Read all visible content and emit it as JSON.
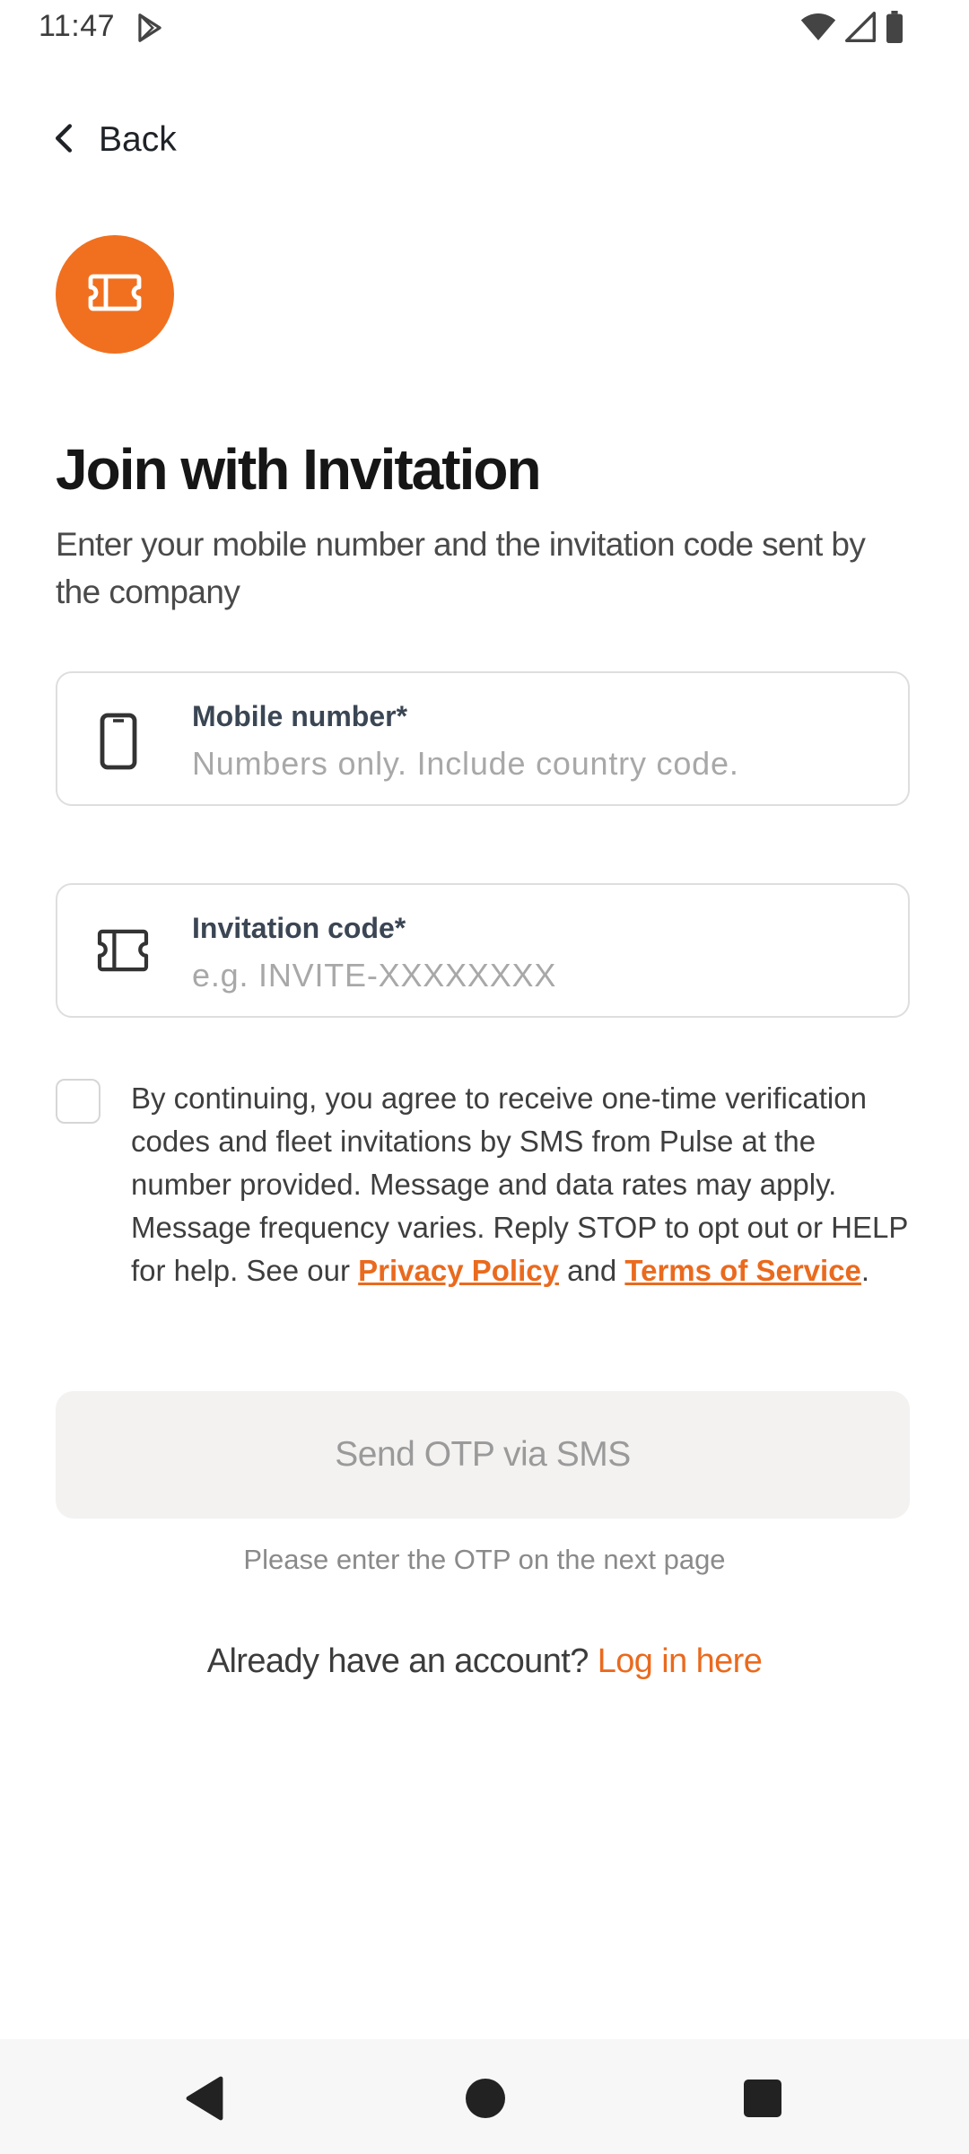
{
  "status_bar": {
    "time": "11:47",
    "icons": [
      "play-store-icon",
      "wifi-icon",
      "cell-signal-icon",
      "battery-icon"
    ]
  },
  "header": {
    "back_label": "Back",
    "back_icon": "chevron-left-icon"
  },
  "brand": {
    "icon": "ticket-icon",
    "accent_color": "#f07020"
  },
  "page": {
    "title": "Join with Invitation",
    "subtitle": "Enter your mobile number and the invitation code sent by the company"
  },
  "fields": {
    "mobile": {
      "icon": "phone-icon",
      "label": "Mobile number*",
      "placeholder": "Numbers only. Include country code.",
      "value": ""
    },
    "invitation": {
      "icon": "ticket-icon",
      "label": "Invitation code*",
      "placeholder": "e.g. INVITE-XXXXXXXX",
      "value": ""
    }
  },
  "consent": {
    "checked": false,
    "text_before": "By continuing, you agree to receive one-time verification codes and fleet invitations by SMS from Pulse at the number provided. Message and data rates may apply. Message frequency varies. Reply STOP to opt out or HELP for help. See our ",
    "privacy_link": "Privacy Policy",
    "text_and": " and ",
    "terms_link": "Terms of Service",
    "text_after": "."
  },
  "actions": {
    "send_otp_label": "Send OTP via SMS",
    "otp_hint": "Please enter the OTP on the next page",
    "login_prompt": "Already have an account? ",
    "login_link": "Log in here"
  },
  "nav_bar": {
    "icons": [
      "nav-back-icon",
      "nav-home-icon",
      "nav-recents-icon"
    ]
  },
  "colors": {
    "accent": "#ea6a1e",
    "disabled_button_bg": "#f3f2f1",
    "disabled_button_text": "#9a9a9a"
  }
}
